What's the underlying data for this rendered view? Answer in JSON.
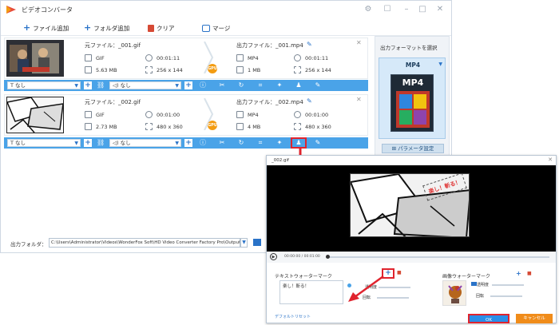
{
  "app": {
    "title": "ビデオコンバータ"
  },
  "toolbar": {
    "add_file": "ファイル追加",
    "add_folder": "フォルダ追加",
    "clear": "クリア",
    "merge": "マージ"
  },
  "files": [
    {
      "source_label": "元ファイル：_001.gif",
      "output_label": "出力ファイル：_001.mp4",
      "src_format": "GIF",
      "src_duration": "00:01:11",
      "src_size": "5.63 MB",
      "src_resolution": "256 x 144",
      "out_format": "MP4",
      "out_duration": "00:01:11",
      "out_size": "1 MB",
      "out_resolution": "256 x 144",
      "subtitle": "なし",
      "audio": "なし"
    },
    {
      "source_label": "元ファイル：_002.gif",
      "output_label": "出力ファイル：_002.mp4",
      "src_format": "GIF",
      "src_duration": "00:01:00",
      "src_size": "2.73 MB",
      "src_resolution": "480 x 360",
      "out_format": "MP4",
      "out_duration": "00:01:00",
      "out_size": "4 MB",
      "out_resolution": "480 x 360",
      "subtitle": "なし",
      "audio": "なし"
    }
  ],
  "gpu_label": "GPU",
  "right_panel": {
    "title": "出力フォーマットを選択",
    "format": "MP4",
    "icon_text": "MP4",
    "param_button": "パラメータ設定"
  },
  "output": {
    "label": "出力フォルダ：",
    "path": "C:\\Users\\Administrator\\Videos\\WonderFox Soft\\HD Video Converter Factory Pro\\OutputVideo\\"
  },
  "watermark_dialog": {
    "title": "_002.gif",
    "overlay_text": "楽し！斬る！",
    "time": "00:00:00 / 00:01:00",
    "text_wm_label": "テキストウォーターマーク",
    "image_wm_label": "画像ウォーターマーク",
    "text_value": "楽し！斬る！",
    "opacity": "透明度",
    "rotate": "回転",
    "img_opacity": "透明度",
    "img_rotate": "回転",
    "reset": "デフォルトリセット",
    "ok": "OK",
    "cancel": "キャンセル"
  },
  "colors": {
    "accent": "#4aa3e8",
    "highlight": "#e0242e",
    "ok": "#2a8ee8",
    "cancel": "#f08c1a"
  }
}
